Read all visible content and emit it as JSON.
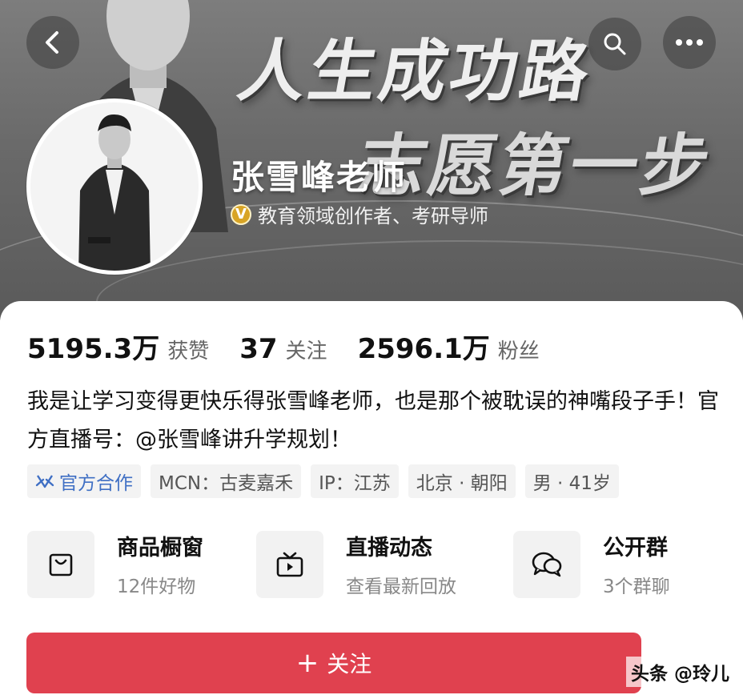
{
  "header": {
    "slogan_line1": "人生成功路",
    "slogan_line2": "志愿第一步",
    "profile_name": "张雪峰老师",
    "verify_badge": "V",
    "verify_text": "教育领域创作者、考研导师"
  },
  "stats": [
    {
      "value": "5195.3万",
      "label": "获赞"
    },
    {
      "value": "37",
      "label": "关注"
    },
    {
      "value": "2596.1万",
      "label": "粉丝"
    }
  ],
  "bio": "我是让学习变得更快乐得张雪峰老师，也是那个被耽误的神嘴段子手！官方直播号：@张雪峰讲升学规划！",
  "tags": [
    {
      "label": "官方合作",
      "icon": "official-cooperation-icon"
    },
    {
      "label": "MCN：古麦嘉禾"
    },
    {
      "label": "IP：江苏"
    },
    {
      "label": "北京 · 朝阳"
    },
    {
      "label": "男 · 41岁"
    }
  ],
  "shortcuts": [
    {
      "title": "商品橱窗",
      "subtitle": "12件好物",
      "icon": "shopping-bag-icon"
    },
    {
      "title": "直播动态",
      "subtitle": "查看最新回放",
      "icon": "tv-icon"
    },
    {
      "title": "公开群",
      "subtitle": "3个群聊",
      "icon": "chat-bubbles-icon"
    }
  ],
  "follow_button": {
    "plus": "+",
    "label": "关注"
  },
  "watermark": "头条 @玲儿",
  "colors": {
    "accent": "#e0414f",
    "official": "#3f6fc4",
    "badge": "#d8a425"
  }
}
